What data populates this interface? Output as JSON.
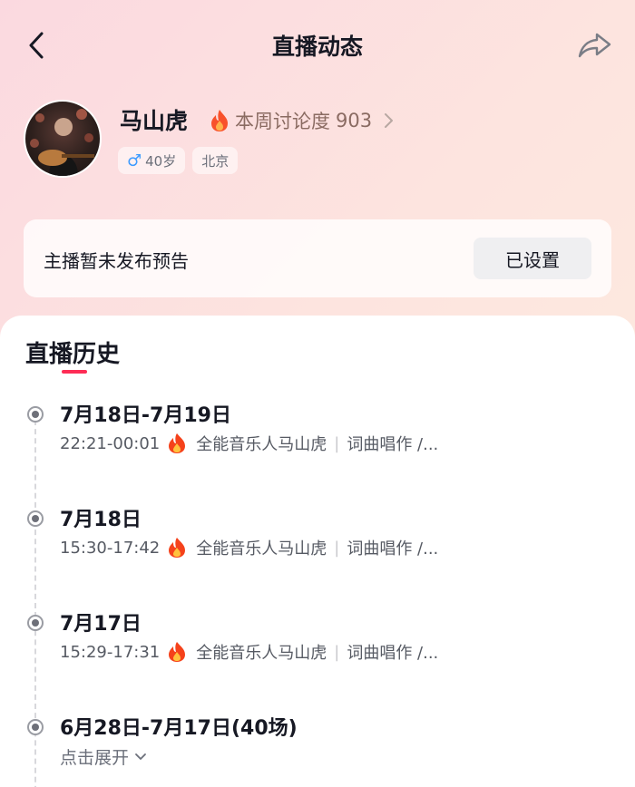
{
  "header": {
    "title": "直播动态"
  },
  "profile": {
    "name": "马山虎",
    "heat_label": "本周讨论度",
    "heat_value": "903",
    "gender_age": "40岁",
    "location": "北京"
  },
  "notice": {
    "text": "主播暂未发布预告",
    "button_label": "已设置"
  },
  "history": {
    "title": "直播历史",
    "entries": [
      {
        "date": "7月18日-7月19日",
        "time": "22:21-00:01",
        "title": "全能音乐人马山虎",
        "tags": "词曲唱作 /..."
      },
      {
        "date": "7月18日",
        "time": "15:30-17:42",
        "title": "全能音乐人马山虎",
        "tags": "词曲唱作 /..."
      },
      {
        "date": "7月17日",
        "time": "15:29-17:31",
        "title": "全能音乐人马山虎",
        "tags": "词曲唱作 /..."
      }
    ],
    "group": {
      "date": "6月28日-7月17日(40场)",
      "expand_label": "点击展开"
    }
  },
  "colors": {
    "accent": "#fe2c55",
    "male": "#3d9bff"
  }
}
